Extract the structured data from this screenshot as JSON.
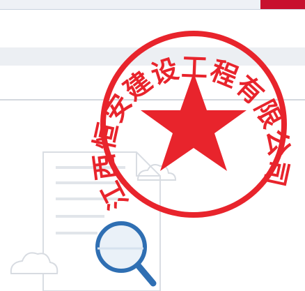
{
  "seal": {
    "text": "江西恒安建设工程有限公司",
    "color": "#e8242c"
  },
  "colors": {
    "accent": "#c8102e",
    "toolbar_bg": "#eceff3",
    "divider": "#d4d8de",
    "illustration_line": "#d9dde3",
    "magnifier": "#2f6fb3"
  },
  "illustration": {
    "icons": [
      "document-icon",
      "cloud-icon",
      "magnifier-icon"
    ]
  }
}
